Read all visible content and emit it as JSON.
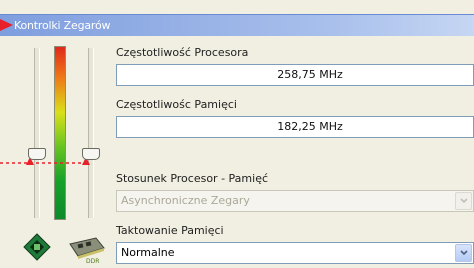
{
  "panel": {
    "title": "Kontrolki Zegarów"
  },
  "cpu": {
    "label": "Częstotliwość Procesora",
    "value": "258,75 MHz"
  },
  "memory": {
    "label": "Częstotliwośc Pamięci",
    "value": "182,25 MHz"
  },
  "ratio": {
    "label": "Stosunek Procesor - Pamięć",
    "selected": "Asynchroniczne Zegary"
  },
  "timing": {
    "label": "Taktowanie Pamięci",
    "selected": "Normalne"
  },
  "icons": {
    "cpu": "cpu-chip-icon",
    "ram": "ram-module-icon"
  },
  "colors": {
    "title_bar": "#8aa8e4",
    "annotation_red": "#e8202a",
    "field_border": "#7f9db9"
  }
}
